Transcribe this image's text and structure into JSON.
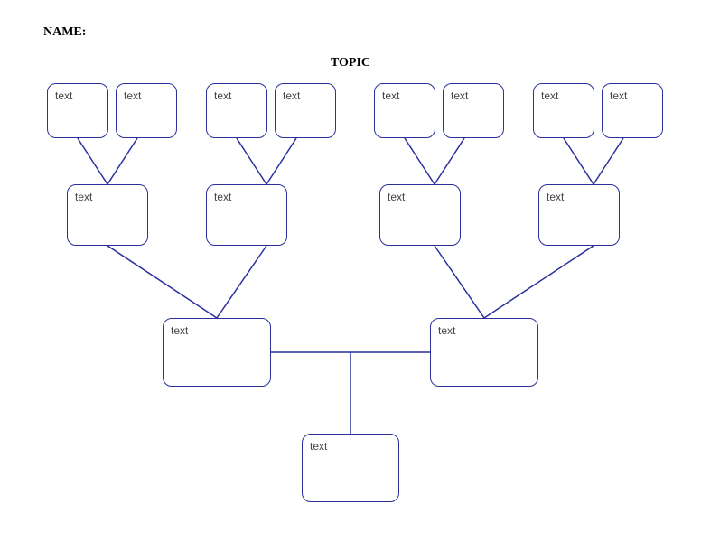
{
  "header": {
    "name_label": "NAME:",
    "topic_label": "TOPIC"
  },
  "colors": {
    "line": "#2a2f9c"
  },
  "boxes": {
    "r1_1": "text",
    "r1_2": "text",
    "r1_3": "text",
    "r1_4": "text",
    "r1_5": "text",
    "r1_6": "text",
    "r1_7": "text",
    "r1_8": "text",
    "r2_1": "text",
    "r2_2": "text",
    "r2_3": "text",
    "r2_4": "text",
    "r3_1": "text",
    "r3_2": "text",
    "r4_1": "text"
  }
}
